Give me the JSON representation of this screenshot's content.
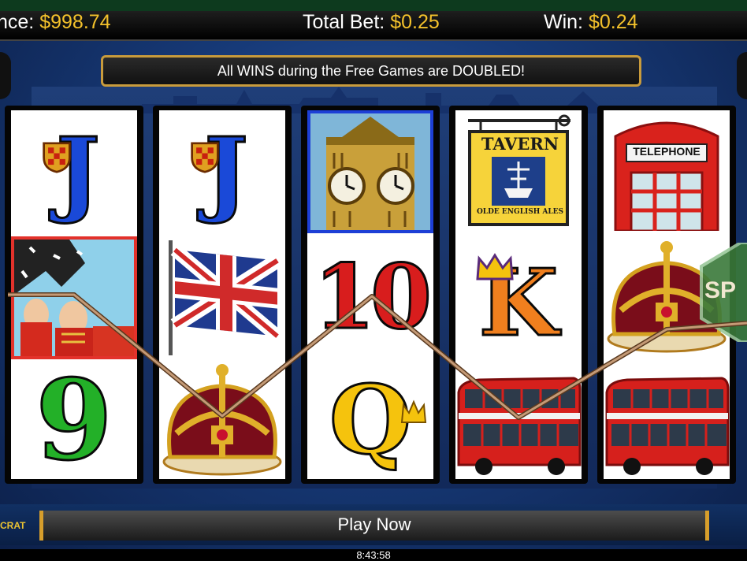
{
  "header": {
    "balance_label": "nce:",
    "balance_value": "$998.74",
    "bet_label": "Total Bet:",
    "bet_value": "$0.25",
    "win_label": "Win:",
    "win_value": "$0.24"
  },
  "banner": {
    "text": "All WINS during the Free Games are DOUBLED!"
  },
  "reels": [
    {
      "symbols": [
        "jack-blue",
        "royal-guards",
        "nine-green"
      ]
    },
    {
      "symbols": [
        "jack-blue",
        "union-jack-flag",
        "crown"
      ]
    },
    {
      "symbols": [
        "big-ben",
        "ten-red",
        "queen-yellow"
      ]
    },
    {
      "symbols": [
        "tavern-sign",
        "king-orange",
        "double-decker-bus"
      ]
    },
    {
      "symbols": [
        "telephone-box",
        "crown",
        "double-decker-bus"
      ]
    }
  ],
  "symbol_text": {
    "jack": "J",
    "nine": "9",
    "ten": "10",
    "queen": "Q",
    "king": "K",
    "tavern": "TAVERN",
    "tavern_sub": "OLDE ENGLISH ALES",
    "telephone": "TELEPHONE",
    "spin_peek": "SP"
  },
  "footer": {
    "play_label": "Play Now",
    "time": "8:43:58",
    "logo_text": "CRAT"
  },
  "colors": {
    "accent_gold": "#f3c12b",
    "banner_border": "#c89b3c",
    "payline": "#b07850"
  }
}
